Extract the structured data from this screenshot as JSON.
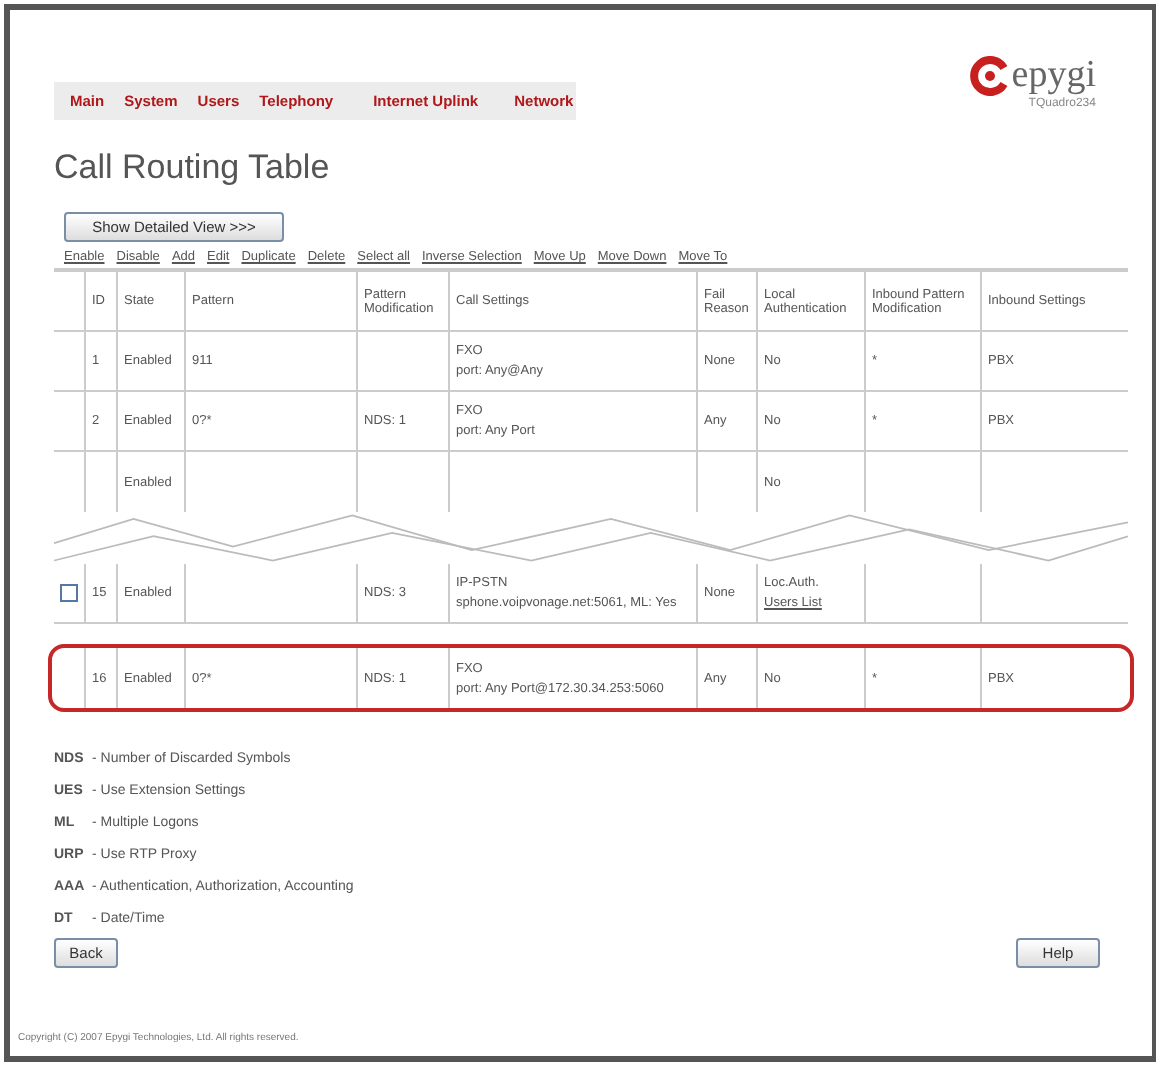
{
  "nav": [
    {
      "label": "Main"
    },
    {
      "label": "System"
    },
    {
      "label": "Users"
    },
    {
      "label": "Telephony"
    },
    {
      "label": "Internet Uplink"
    },
    {
      "label": "Network"
    }
  ],
  "logo": {
    "brand": "epygi",
    "model": "TQuadro234"
  },
  "title": "Call Routing Table",
  "detail_button": "Show Detailed View >>>",
  "actions": [
    "Enable",
    "Disable",
    "Add",
    "Edit",
    "Duplicate",
    "Delete",
    "Select all",
    "Inverse Selection",
    "Move Up",
    "Move Down",
    "Move To"
  ],
  "table": {
    "columns": [
      "",
      "ID",
      "State",
      "Pattern",
      "Pattern Modification",
      "Call Settings",
      "Fail Reason",
      "Local Authentication",
      "Inbound Pattern Modification",
      "Inbound Settings"
    ],
    "rows": [
      {
        "kind": "full",
        "highlighted": false,
        "id": "1",
        "state": "Enabled",
        "pattern": "911",
        "pattern_mod": "",
        "call": [
          "FXO",
          "port: Any@Any"
        ],
        "fail": "None",
        "auth": [
          "No"
        ],
        "inbound_mod": "*",
        "inbound": "PBX"
      },
      {
        "kind": "full",
        "highlighted": false,
        "id": "2",
        "state": "Enabled",
        "pattern": "0?*",
        "pattern_mod": "NDS: 1",
        "call": [
          "FXO",
          "port: Any Port"
        ],
        "fail": "Any",
        "auth": [
          "No"
        ],
        "inbound_mod": "*",
        "inbound": "PBX"
      },
      {
        "kind": "torn",
        "highlighted": false,
        "id": "",
        "state": "Enabled",
        "pattern": "",
        "pattern_mod": "",
        "call": [],
        "fail": "",
        "auth": [
          "No"
        ],
        "inbound_mod": "",
        "inbound": ""
      },
      {
        "kind": "full",
        "highlighted": false,
        "checked": false,
        "id": "15",
        "state": "Enabled",
        "pattern": "",
        "pattern_mod": "NDS: 3",
        "call": [
          "IP-PSTN",
          "sphone.voipvonage.net:5061, ML: Yes"
        ],
        "fail": "None",
        "auth": [
          "Loc.Auth.",
          "Users List"
        ],
        "inbound_mod": "",
        "inbound": ""
      },
      {
        "kind": "full",
        "highlighted": true,
        "id": "16",
        "state": "Enabled",
        "pattern": "0?*",
        "pattern_mod": "NDS: 1",
        "call": [
          "FXO",
          "port: Any Port@172.30.34.253:5060"
        ],
        "fail": "Any",
        "auth": [
          "No"
        ],
        "inbound_mod": "*",
        "inbound": "PBX"
      }
    ]
  },
  "legend": [
    {
      "abbr": "NDS",
      "text": "- Number of Discarded Symbols"
    },
    {
      "abbr": "UES",
      "text": "- Use Extension Settings"
    },
    {
      "abbr": "ML",
      "text": "- Multiple Logons"
    },
    {
      "abbr": "URP",
      "text": "- Use RTP Proxy"
    },
    {
      "abbr": "AAA",
      "text": "- Authentication, Authorization, Accounting"
    },
    {
      "abbr": "DT",
      "text": "- Date/Time"
    }
  ],
  "back_button": "Back",
  "help_button": "Help",
  "copyright": "Copyright (C) 2007 Epygi Technologies, Ltd. All rights reserved."
}
